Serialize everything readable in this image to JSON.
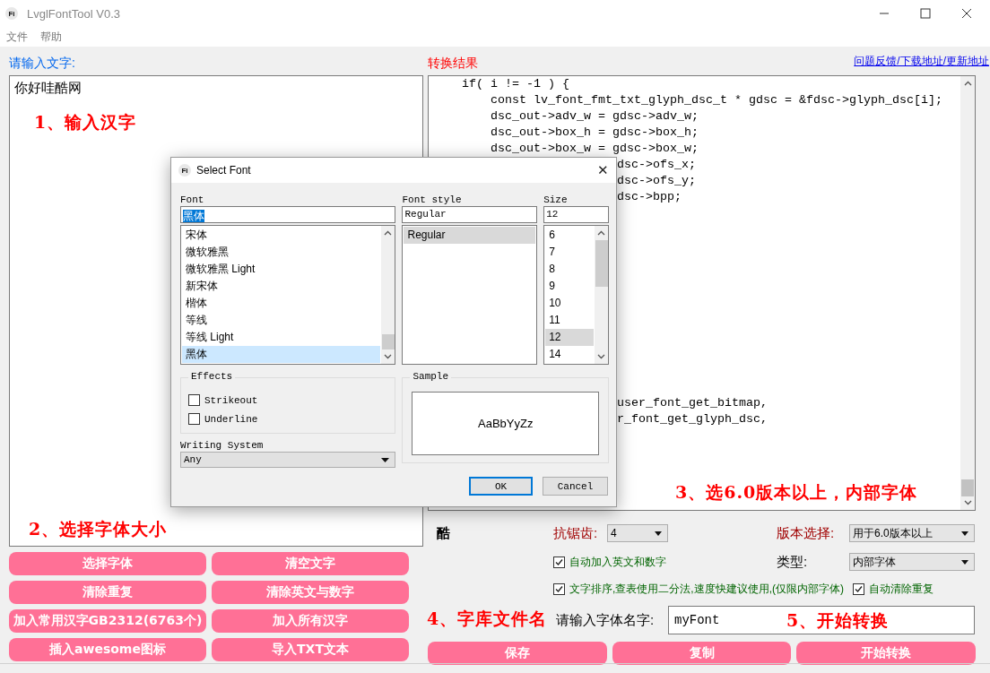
{
  "window": {
    "icon_text": "Fi",
    "title": "LvglFontTool V0.3"
  },
  "menu": [
    {
      "label": "文件"
    },
    {
      "label": "帮助"
    }
  ],
  "input_panel": {
    "label": "请输入文字:",
    "text": "你好哇酷网"
  },
  "left_buttons": [
    "选择字体",
    "清空文字",
    "清除重复",
    "清除英文与数字",
    "加入常用汉字GB2312(6763个)",
    "加入所有汉字",
    "插入awesome图标",
    "导入TXT文本"
  ],
  "output_panel": {
    "label": "转换结果",
    "link": "问题反馈/下载地址/更新地址",
    "code_lines": [
      {
        "kind": "indent1",
        "text": "if( i != -1 ) {"
      },
      {
        "kind": "indent2",
        "text": "const lv_font_fmt_txt_glyph_dsc_t * gdsc = &fdsc->glyph_dsc[i];"
      },
      {
        "kind": "indent2",
        "text": "dsc_out->adv_w = gdsc->adv_w;"
      },
      {
        "kind": "indent2",
        "text": "dsc_out->box_h = gdsc->box_h;"
      },
      {
        "kind": "indent2",
        "text": "dsc_out->box_w = gdsc->box_w;"
      },
      {
        "kind": "tail",
        "text": "dsc->ofs_x;"
      },
      {
        "kind": "tail",
        "text": "dsc->ofs_y;"
      },
      {
        "kind": "tail",
        "text": "dsc->bpp;"
      }
    ],
    "code_lines_lower": [
      {
        "kind": "tail",
        "text": "user_font_get_bitmap,"
      },
      {
        "kind": "tail",
        "text": "r_font_get_glyph_dsc,"
      }
    ]
  },
  "options": {
    "preview_glyph": "酷",
    "antialias": {
      "label": "抗锯齿:",
      "value": "4"
    },
    "version": {
      "label": "版本选择:",
      "value": "用于6.0版本以上"
    },
    "type": {
      "label": "类型:",
      "value": "内部字体"
    },
    "checkboxes": [
      {
        "label": "自动加入英文和数字",
        "checked": true
      },
      {
        "label": "文字排序,查表使用二分法,速度快建议使用,(仅限内部字体)",
        "checked": true
      },
      {
        "label": "自动清除重复",
        "checked": true
      }
    ],
    "font_name": {
      "label": "请输入字体名字:",
      "value": "myFont"
    }
  },
  "bottom_buttons": [
    "保存",
    "复制",
    "开始转换"
  ],
  "annotations": [
    {
      "kind": "input",
      "text": "1、输入汉字"
    },
    {
      "kind": "size",
      "text": "2、选择字体大小"
    },
    {
      "kind": "version",
      "text": "3、选6.0版本以上，内部字体"
    },
    {
      "kind": "filename",
      "text": "4、字库文件名"
    },
    {
      "kind": "convert",
      "text": "5、开始转换"
    }
  ],
  "dialog": {
    "icon_text": "Fi",
    "title": "Select Font",
    "close": "✕",
    "font_label": "Font",
    "font_value": "黑体",
    "fonts": [
      {
        "label": "宋体",
        "selected": false
      },
      {
        "label": "微软雅黑",
        "selected": false
      },
      {
        "label": "微软雅黑 Light",
        "selected": false
      },
      {
        "label": "新宋体",
        "selected": false
      },
      {
        "label": "楷体",
        "selected": false
      },
      {
        "label": "等线",
        "selected": false
      },
      {
        "label": "等线 Light",
        "selected": false
      },
      {
        "label": "黑体",
        "selected": true
      }
    ],
    "style_label": "Font style",
    "style_value": "Regular",
    "styles": [
      {
        "label": "Regular",
        "selected": true
      }
    ],
    "size_label": "Size",
    "size_value": "12",
    "sizes": [
      {
        "label": "6",
        "selected": false
      },
      {
        "label": "7",
        "selected": false
      },
      {
        "label": "8",
        "selected": false
      },
      {
        "label": "9",
        "selected": false
      },
      {
        "label": "10",
        "selected": false
      },
      {
        "label": "11",
        "selected": false
      },
      {
        "label": "12",
        "selected": true
      },
      {
        "label": "14",
        "selected": false
      }
    ],
    "effects_label": "Effects",
    "effects": [
      {
        "label": "Strikeout",
        "checked": false
      },
      {
        "label": "Underline",
        "checked": false
      }
    ],
    "writing_label": "Writing System",
    "writing_value": "Any",
    "sample_label": "Sample",
    "sample_text": "AaBbYyZz",
    "buttons": [
      {
        "label": "OK",
        "kind": "default"
      },
      {
        "label": "Cancel",
        "kind": "normal"
      }
    ]
  }
}
